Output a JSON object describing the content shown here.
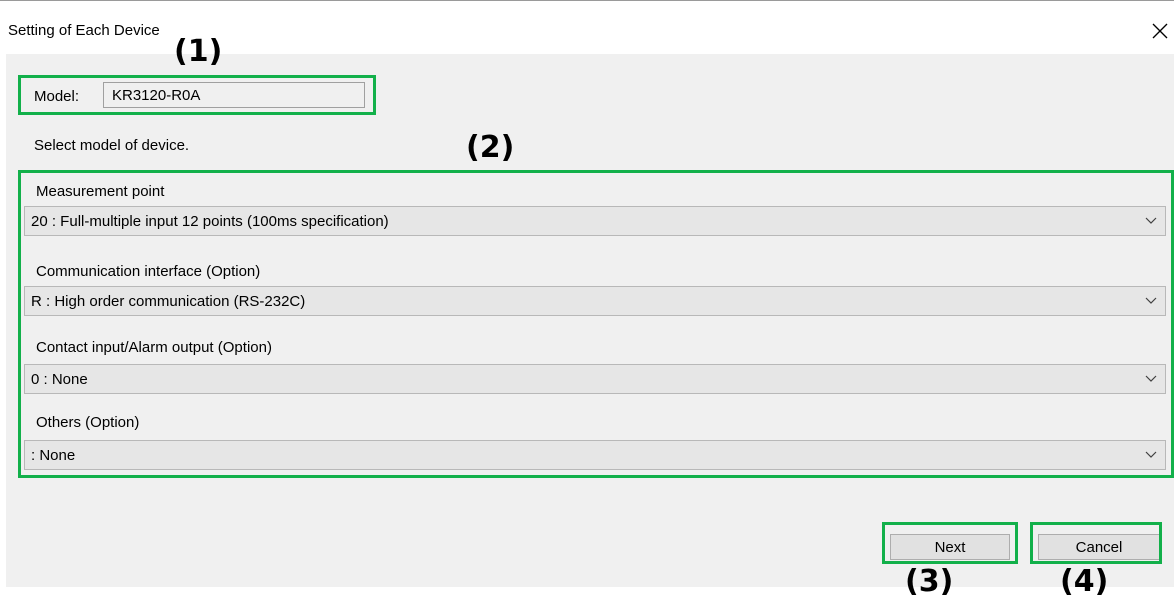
{
  "window": {
    "title": "Setting of Each Device"
  },
  "model": {
    "label": "Model:",
    "value": "KR3120-R0A"
  },
  "hint": "Select model of device.",
  "fields": [
    {
      "label": "Measurement point",
      "value": "20 : Full-multiple input 12 points (100ms specification)"
    },
    {
      "label": "Communication interface (Option)",
      "value": "R : High order communication (RS-232C)"
    },
    {
      "label": "Contact input/Alarm output (Option)",
      "value": "0 : None"
    },
    {
      "label": "Others (Option)",
      "value": ": None"
    }
  ],
  "buttons": {
    "next": "Next",
    "cancel": "Cancel"
  },
  "annotations": {
    "a1": "(1)",
    "a2": "(2)",
    "a3": "(3)",
    "a4": "(4)"
  },
  "colors": {
    "highlight": "#12b04a",
    "panel": "#f0f0f0",
    "combo": "#e6e6e6"
  }
}
